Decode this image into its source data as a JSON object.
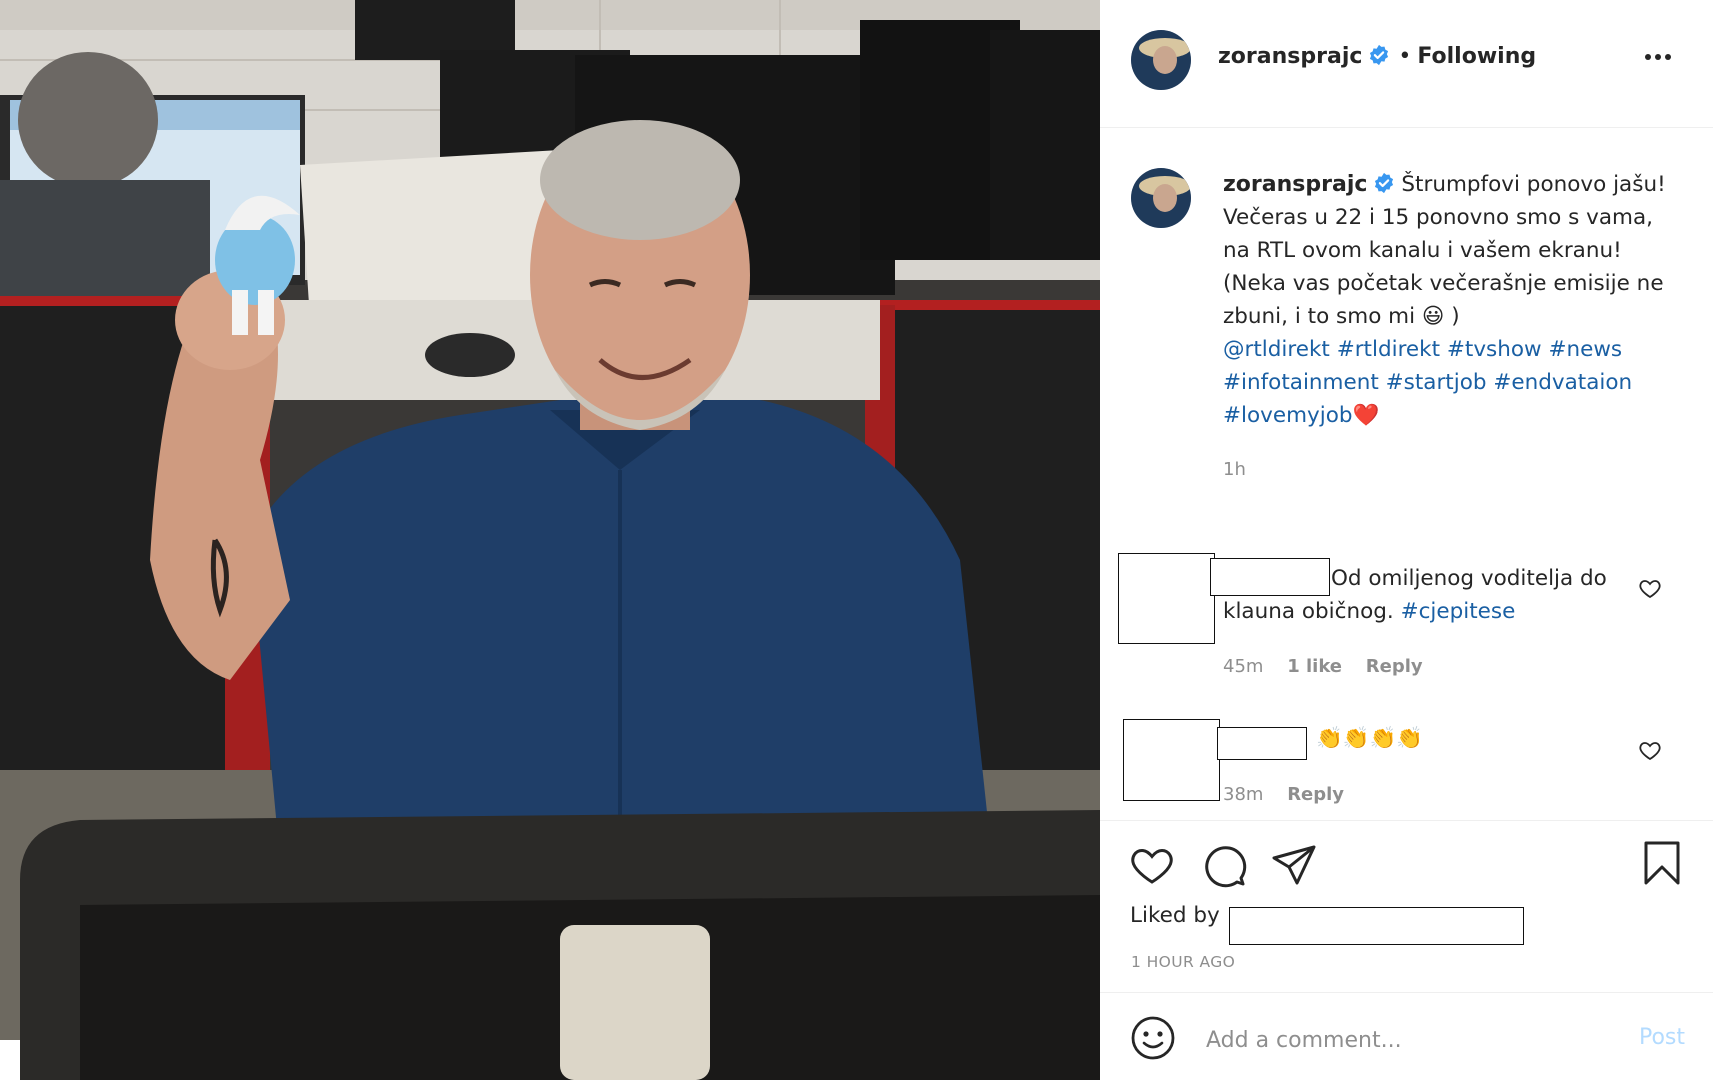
{
  "photo": {
    "alt_icon": "photo-of-man-holding-smurf-toy"
  },
  "header": {
    "username": "zoransprajc",
    "verified_icon": "verified-badge-icon",
    "separator": "•",
    "follow_status": "Following",
    "more_icon": "more-options-icon"
  },
  "caption": {
    "username": "zoransprajc",
    "line1": "Štrumpfovi ponovo jašu! Večeras u 22 i 15 ponovno smo s vama, na RTL ovom kanalu i vašem ekranu!",
    "line2": "(Neka vas početak večerašnje emisije ne zbuni, i to smo mi",
    "emoji": "😃",
    "line2_end": ")",
    "hashtags": [
      "@rtldirekt",
      "#rtldirekt",
      "#tvshow",
      "#news",
      "#infotainment",
      "#startjob",
      "#endvataion",
      "#lovemyjob"
    ],
    "heart_emoji": "❤️",
    "time": "1h"
  },
  "comments": [
    {
      "text": "Od omiljenog voditelja do klauna običnog.",
      "hashtag": "#cjepitese",
      "time": "45m",
      "likes": "1 like",
      "reply": "Reply"
    },
    {
      "text": "👏👏👏👏",
      "time": "38m",
      "reply": "Reply"
    }
  ],
  "actions": {
    "like_icon": "heart-icon",
    "comment_icon": "comment-icon",
    "share_icon": "share-icon",
    "save_icon": "bookmark-icon",
    "liked_by_label": "Liked by",
    "time_ago": "1 HOUR AGO"
  },
  "add_comment": {
    "emoji_icon": "emoji-icon",
    "placeholder": "Add a comment...",
    "post_label": "Post"
  },
  "colors": {
    "link": "#1a5fa3",
    "muted": "#8e8e8e",
    "post_disabled": "#b3dbff",
    "verified": "#3897f0"
  }
}
